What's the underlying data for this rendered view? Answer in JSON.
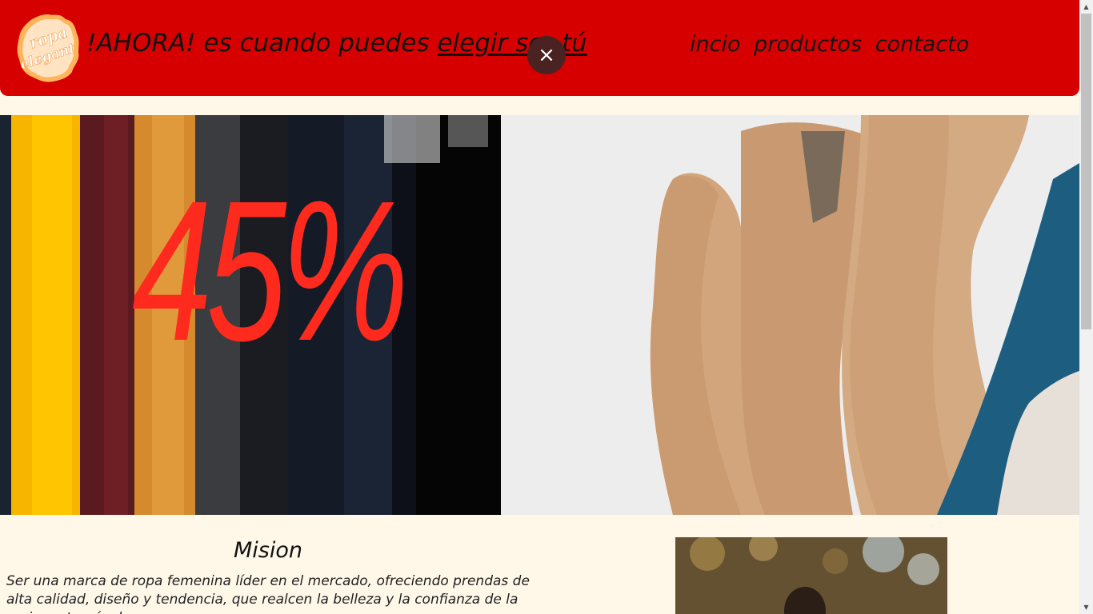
{
  "header": {
    "logo_text": "ropa elegant",
    "tagline_prefix": "!AHORA! es cuando puedes ",
    "tagline_link": "elegir ser tú",
    "close_label": "×",
    "nav": [
      {
        "label": "incio"
      },
      {
        "label": "productos"
      },
      {
        "label": "contacto"
      }
    ],
    "bg_color": "#d60000"
  },
  "banner": {
    "discount_text": "45%",
    "discount_color": "#ff2a1e"
  },
  "mission": {
    "title": "Mision",
    "text": "Ser una marca de ropa femenina líder en el mercado, ofreciendo prendas de alta calidad, diseño y tendencia, que realcen la belleza y la confianza de la mujer, a través de una"
  },
  "colors": {
    "page_bg": "#fff7e8",
    "accent": "#d60000"
  },
  "icons": {
    "close": "close-icon",
    "scroll_up": "scroll-up-arrow-icon",
    "scroll_down": "scroll-down-arrow-icon"
  }
}
